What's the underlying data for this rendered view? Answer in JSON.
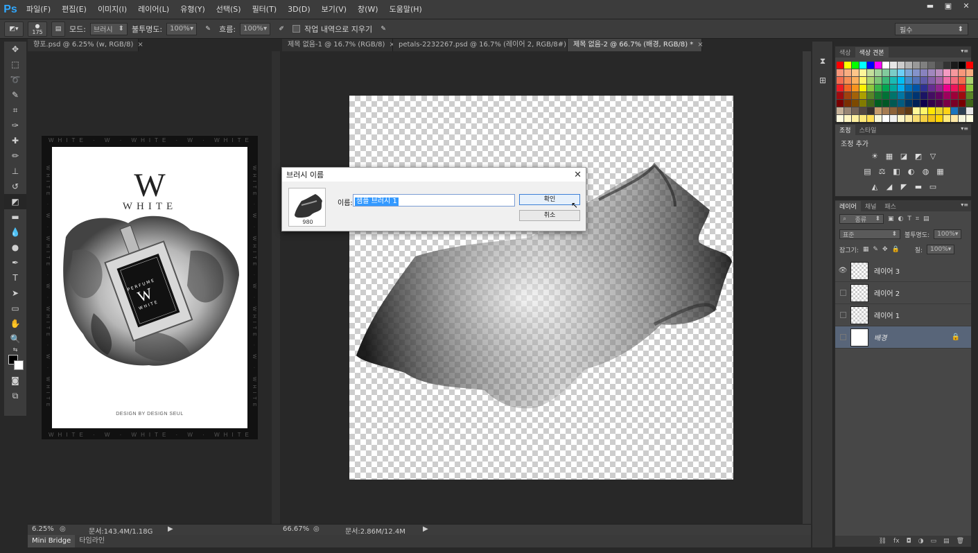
{
  "app": {
    "logo": "Ps"
  },
  "menu": [
    "파일(F)",
    "편집(E)",
    "이미지(I)",
    "레이어(L)",
    "유형(Y)",
    "선택(S)",
    "필터(T)",
    "3D(D)",
    "보기(V)",
    "창(W)",
    "도움말(H)"
  ],
  "window_controls": {
    "minimize": "▬",
    "maximize": "▣",
    "close": "✕"
  },
  "options": {
    "brush_size": "175",
    "mode_label": "모드:",
    "mode_value": "브러시",
    "opacity_label": "불투명도:",
    "opacity_value": "100%",
    "flow_label": "흐름:",
    "flow_value": "100%",
    "erase_history_label": "작업 내역으로 지우기",
    "workspace": "필수"
  },
  "tabs": [
    {
      "label": "향포.psd @ 6.25% (w, RGB/8)"
    },
    {
      "label": "제목 없음-1 @ 16.7% (RGB/8)"
    },
    {
      "label": "petals-2232267.psd @ 16.7% (레이어 2, RGB/8#) *"
    },
    {
      "label": "제목 없음-2 @ 66.7% (배경, RGB/8) *"
    }
  ],
  "tab_close": "×",
  "poster": {
    "monogram": "W",
    "wordmark": "WHITE",
    "bottle_top": "PERFUME",
    "bottle_w": "W",
    "bottle_bottom": "WHITE",
    "credit": "DESIGN BY DESIGN SEUL",
    "frame_text": "WHITE · W · WHITE · W · WHITE · W · WHITE"
  },
  "dialog": {
    "title": "브러시 이름",
    "close": "✕",
    "brush_size": "980",
    "name_label": "이름:",
    "name_value": "샘플 브러시 1",
    "ok": "확인",
    "cancel": "취소"
  },
  "status": {
    "left_zoom": "6.25%",
    "left_doc": "문서:143.4M/1.18G",
    "right_zoom": "66.67%",
    "right_doc": "문서:2.86M/12.4M"
  },
  "bottom_tabs": [
    "Mini Bridge",
    "타임라인"
  ],
  "swatches_panel": {
    "tabs": [
      "색상",
      "색상 견본"
    ],
    "colors": [
      "#ff0000",
      "#ffff00",
      "#00ff00",
      "#00ffff",
      "#0000ff",
      "#ff00ff",
      "#ffffff",
      "#e6e6e6",
      "#cccccc",
      "#b3b3b3",
      "#999999",
      "#808080",
      "#666666",
      "#4d4d4d",
      "#333333",
      "#1a1a1a",
      "#000000",
      "#ff0000",
      "#f7977a",
      "#f9ad81",
      "#fdc68a",
      "#fff79a",
      "#c4df9b",
      "#a2d39c",
      "#82ca9d",
      "#7bcdc8",
      "#6ecff6",
      "#7ea7d8",
      "#8493ca",
      "#8882be",
      "#a187be",
      "#bc8dbf",
      "#f49ac2",
      "#f6989d",
      "#f7977a",
      "#f9ad81",
      "#f26c4f",
      "#f68e55",
      "#fbaf5c",
      "#fff467",
      "#acd372",
      "#7cc576",
      "#3bb878",
      "#1abbb4",
      "#00bff3",
      "#438ccb",
      "#5574b9",
      "#605ca8",
      "#855fa8",
      "#a763a8",
      "#f06ea9",
      "#f26d7d",
      "#f26c4f",
      "#acd372",
      "#ed1c24",
      "#f26522",
      "#f7941d",
      "#fff200",
      "#8dc73f",
      "#39b54a",
      "#00a651",
      "#00a99d",
      "#00aeef",
      "#0072bc",
      "#0054a6",
      "#2e3192",
      "#662d91",
      "#92278f",
      "#ec008c",
      "#ed145b",
      "#ed1c24",
      "#8dc73f",
      "#9e0b0f",
      "#a0410d",
      "#a36209",
      "#aba000",
      "#598527",
      "#1a7b30",
      "#007236",
      "#00746b",
      "#0076a3",
      "#004b80",
      "#003471",
      "#1b1464",
      "#440e62",
      "#630460",
      "#9e005d",
      "#9e0039",
      "#9e0b0f",
      "#598527",
      "#790000",
      "#7b2e00",
      "#7d4900",
      "#827b00",
      "#406618",
      "#005e20",
      "#005826",
      "#005952",
      "#005b7f",
      "#003663",
      "#002157",
      "#0d004c",
      "#32004b",
      "#4b0049",
      "#7b0046",
      "#7a0026",
      "#790000",
      "#406618",
      "#c7b299",
      "#998675",
      "#736357",
      "#534741",
      "#37302d",
      "#c69c6d",
      "#a67c52",
      "#8c6239",
      "#754c24",
      "#603913",
      "#fff799",
      "#fff568",
      "#ffe600",
      "#e9d42c",
      "#fcd116",
      "#1c75bc",
      "#2c3e50",
      "#e6e6e6",
      "#fffbe0",
      "#fff6c2",
      "#fff0a0",
      "#ffe87a",
      "#ffdd55",
      "#f6f6dc",
      "#ffffff",
      "#f0f0f0",
      "#fdf5c9",
      "#fbeaa2",
      "#f8dd71",
      "#f5d042",
      "#f2c318",
      "#ffd400",
      "#ffeb7b",
      "#ffe9a6",
      "#f5f5dc",
      "#ffffe0"
    ]
  },
  "adjustments_panel": {
    "tabs": [
      "조정",
      "스타일"
    ],
    "title": "조정 추가",
    "row1": [
      "☀",
      "▦",
      "◪",
      "◩",
      "▽"
    ],
    "row2": [
      "▤",
      "⚖",
      "◧",
      "◐",
      "◍",
      "▦"
    ],
    "row3": [
      "◭",
      "◢",
      "◤",
      "▬",
      "▭"
    ]
  },
  "layers_panel": {
    "tabs": [
      "레이어",
      "채널",
      "패스"
    ],
    "filter": "종류",
    "blend_mode": "표준",
    "opacity_label": "불투명도:",
    "opacity_value": "100%",
    "lock_label": "잠그기:",
    "fill_label": "칠:",
    "fill_value": "100%",
    "layers": [
      {
        "name": "레이어 3",
        "visible": true
      },
      {
        "name": "레이어 2",
        "visible": false
      },
      {
        "name": "레이어 1",
        "visible": false
      },
      {
        "name": "배경",
        "visible": false
      }
    ],
    "footer_icons": [
      "⛓",
      "fx",
      "◘",
      "◑",
      "▭",
      "▤",
      "🗑"
    ]
  }
}
